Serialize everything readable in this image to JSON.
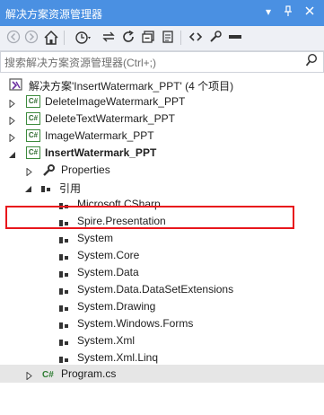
{
  "window": {
    "title": "解决方案资源管理器",
    "pin_icon": "pin-icon",
    "close_icon": "close-icon",
    "dropdown_icon": "dropdown-icon"
  },
  "toolbar": {
    "buttons": [
      {
        "name": "back-icon"
      },
      {
        "name": "forward-icon"
      },
      {
        "name": "home-icon"
      },
      {
        "name": "history-icon"
      },
      {
        "name": "sync-icon"
      },
      {
        "name": "refresh-icon"
      },
      {
        "name": "collapse-all-icon"
      },
      {
        "name": "show-files-icon"
      },
      {
        "name": "code-view-icon"
      },
      {
        "name": "properties-icon"
      },
      {
        "name": "preview-icon"
      }
    ]
  },
  "search": {
    "placeholder": "搜索解决方案资源管理器(Ctrl+;)",
    "icon": "search-icon"
  },
  "tree": {
    "solution": {
      "label": "解决方案'InsertWatermark_PPT' (4 个项目)"
    },
    "projects": [
      {
        "label": "DeleteImageWatermark_PPT"
      },
      {
        "label": "DeleteTextWatermark_PPT"
      },
      {
        "label": "ImageWatermark_PPT"
      },
      {
        "label": "InsertWatermark_PPT"
      }
    ],
    "properties": {
      "label": "Properties"
    },
    "references": {
      "label": "引用",
      "items": [
        "Microsoft.CSharp",
        "Spire.Presentation",
        "System",
        "System.Core",
        "System.Data",
        "System.Data.DataSetExtensions",
        "System.Drawing",
        "System.Windows.Forms",
        "System.Xml",
        "System.Xml.Linq"
      ]
    },
    "program": {
      "label": "Program.cs"
    },
    "highlighted_item": "Spire.Presentation"
  },
  "colors": {
    "titlebar": "#4a90e2",
    "highlight_border": "#e8161c",
    "selected_row": "#e6e6e6"
  }
}
